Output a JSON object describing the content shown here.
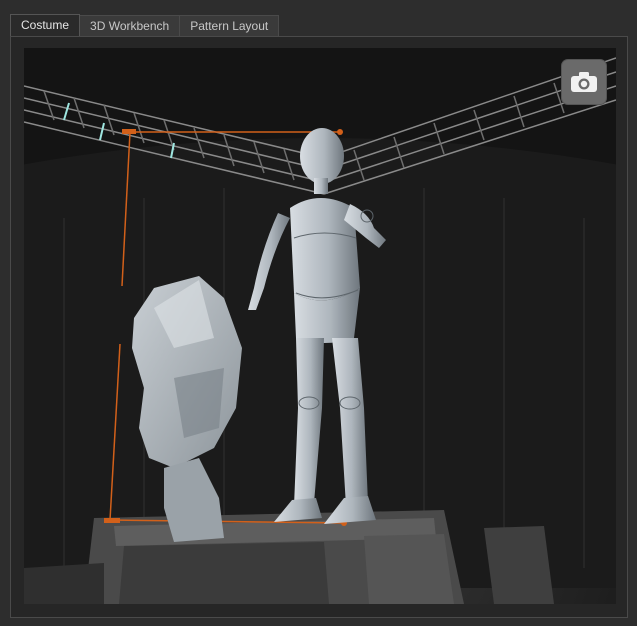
{
  "tabs": [
    {
      "label": "Costume",
      "active": true
    },
    {
      "label": "3D Workbench",
      "active": false
    },
    {
      "label": "Pattern Layout",
      "active": false
    }
  ],
  "viewport": {
    "background": "#151515",
    "toolbar": {
      "snapshot_icon": "camera-icon"
    }
  },
  "colors": {
    "accent_lines": "#d2601a",
    "figure": "#b9c0c6",
    "frame": "#2d2d2d"
  }
}
